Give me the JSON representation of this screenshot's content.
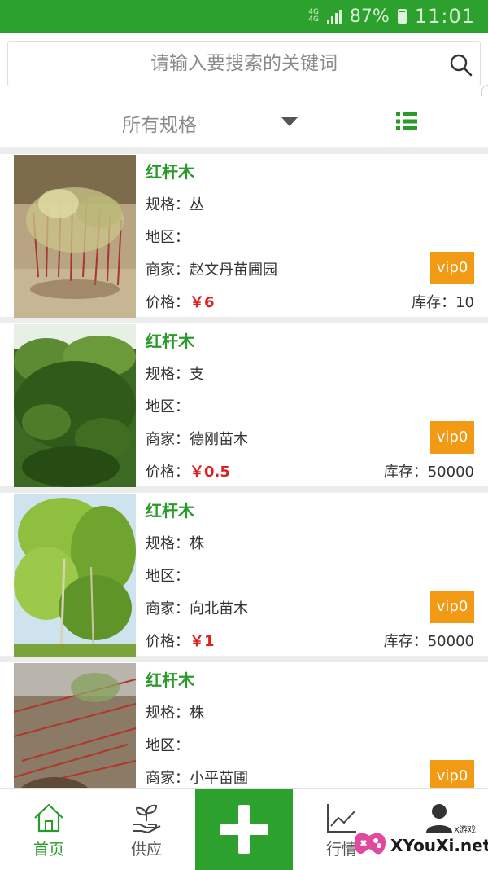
{
  "status_bar": {
    "network_top": "4G",
    "network_bottom": "4G",
    "battery_pct": "87%",
    "time": "11:01"
  },
  "search": {
    "placeholder": "请输入要搜索的关键词",
    "icon": "search-icon"
  },
  "filter": {
    "spec_label": "所有规格",
    "caret_icon": "caret-down-icon",
    "view_icon": "list-view-icon",
    "accent": "#2a9a2a"
  },
  "labels": {
    "spec": "规格：",
    "region": "地区：",
    "seller": "商家：",
    "price": "价格：",
    "stock": "库存："
  },
  "products": [
    {
      "name": "红杆木",
      "spec": "丛",
      "region": "",
      "seller": "赵文丹苗圃园",
      "price": "￥6",
      "stock": "10",
      "badge": "vip0"
    },
    {
      "name": "红杆木",
      "spec": "支",
      "region": "",
      "seller": "德刚苗木",
      "price": "￥0.5",
      "stock": "50000",
      "badge": "vip0"
    },
    {
      "name": "红杆木",
      "spec": "株",
      "region": "",
      "seller": "向北苗木",
      "price": "￥1",
      "stock": "50000",
      "badge": "vip0"
    },
    {
      "name": "红杆木",
      "spec": "株",
      "region": "",
      "seller": "小平苗圃",
      "price": "",
      "stock": "",
      "badge": "vip0"
    }
  ],
  "bottom_nav": {
    "home": "首页",
    "supply": "供应",
    "add_icon": "plus-icon",
    "market": "行情",
    "profile_icon": "user-icon"
  },
  "watermark": {
    "text": "XYouXi.net",
    "sub": "X游戏"
  },
  "colors": {
    "brand_green": "#2da12d",
    "price_red": "#e02020",
    "badge_orange": "#f39a14"
  }
}
